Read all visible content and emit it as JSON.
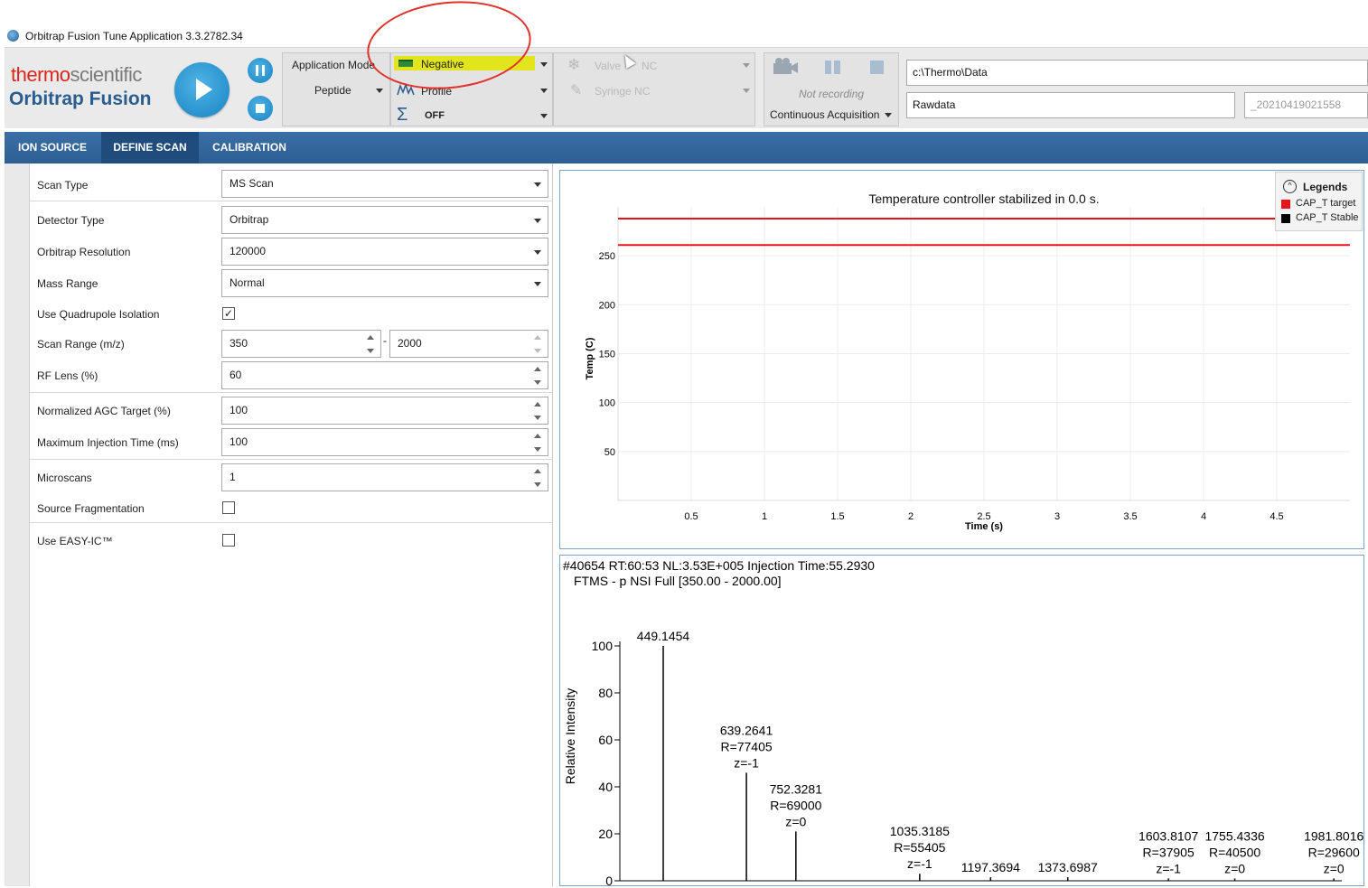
{
  "window": {
    "title": "Orbitrap Fusion Tune Application 3.3.2782.34"
  },
  "brand": {
    "thermo_red": "thermo",
    "thermo_grey": "scientific",
    "product": "Orbitrap Fusion"
  },
  "toolbar": {
    "app_mode_label": "Application Mode",
    "app_mode_value": "Peptide",
    "polarity": "Negative",
    "scan_data": "Profile",
    "sum_mode": "OFF",
    "valve_label": "Valve",
    "valve_value": "NC",
    "syringe": "Syringe NC",
    "recording_status": "Not recording",
    "acquisition_mode": "Continuous Acquisition",
    "data_path": "c:\\Thermo\\Data",
    "file_name": "Rawdata",
    "file_suffix": "_20210419021558"
  },
  "tabs": [
    {
      "label": "ION SOURCE"
    },
    {
      "label": "DEFINE SCAN"
    },
    {
      "label": "CALIBRATION"
    }
  ],
  "params": {
    "scan_type_label": "Scan Type",
    "scan_type": "MS Scan",
    "detector_label": "Detector Type",
    "detector": "Orbitrap",
    "resolution_label": "Orbitrap Resolution",
    "resolution": "120000",
    "mass_range_label": "Mass Range",
    "mass_range": "Normal",
    "quad_label": "Use Quadrupole Isolation",
    "quad_checked": "✓",
    "scan_range_label": "Scan Range (m/z)",
    "scan_min": "350",
    "scan_sep": "-",
    "scan_max": "2000",
    "rf_label": "RF Lens (%)",
    "rf": "60",
    "agc_label": "Normalized AGC Target (%)",
    "agc": "100",
    "inj_label": "Maximum Injection Time (ms)",
    "inj": "100",
    "micro_label": "Microscans",
    "micro": "1",
    "srcfrag_label": "Source Fragmentation",
    "easyic_label": "Use EASY-IC™"
  },
  "legend": {
    "title": "Legends",
    "items": [
      {
        "name": "CAP_T target",
        "color": "#e8141a"
      },
      {
        "name": "CAP_T Stable",
        "color": "#000000"
      }
    ]
  },
  "chart_data": [
    {
      "type": "line",
      "title": "Temperature controller stabilized in 0.0 s.",
      "xlabel": "Time (s)",
      "ylabel": "Temp (C)",
      "x_ticks": [
        "0.5",
        "1",
        "1.5",
        "2",
        "2.5",
        "3",
        "3.5",
        "4",
        "4.5"
      ],
      "y_ticks": [
        "50",
        "100",
        "150",
        "200",
        "250"
      ],
      "xlim": [
        0,
        5
      ],
      "ylim": [
        0,
        300
      ],
      "series": [
        {
          "name": "CAP_T target",
          "x": [
            0,
            5
          ],
          "y": [
            288,
            288
          ],
          "color": "#e8141a"
        },
        {
          "name": "CAP_T Stable",
          "x": [
            0,
            5
          ],
          "y": [
            261,
            261
          ],
          "color": "#e8141a"
        }
      ]
    },
    {
      "type": "bar",
      "header1": "#40654    RT:60:53        NL:3.53E+005        Injection Time:55.2930",
      "header2": "FTMS - p NSI Full [350.00 - 2000.00]",
      "ylabel": "Relative Intensity",
      "y_ticks": [
        "0",
        "20",
        "40",
        "60",
        "80",
        "100"
      ],
      "xlim": [
        350,
        2000
      ],
      "ylim": [
        0,
        100
      ],
      "peaks": [
        {
          "mz": 449.1454,
          "y": 100,
          "label": [
            "449.1454"
          ]
        },
        {
          "mz": 639.2641,
          "y": 46,
          "label": [
            "639.2641",
            "R=77405",
            "z=-1"
          ]
        },
        {
          "mz": 752.3281,
          "y": 21,
          "label": [
            "752.3281",
            "R=69000",
            "z=0"
          ]
        },
        {
          "mz": 1035.3185,
          "y": 3,
          "label": [
            "1035.3185",
            "R=55405",
            "z=-1"
          ]
        },
        {
          "mz": 1197.3694,
          "y": 1.5,
          "label": [
            "1197.3694"
          ]
        },
        {
          "mz": 1373.6987,
          "y": 1.5,
          "label": [
            "1373.6987"
          ]
        },
        {
          "mz": 1603.8107,
          "y": 1,
          "label": [
            "1603.8107",
            "R=37905",
            "z=-1"
          ]
        },
        {
          "mz": 1755.4336,
          "y": 1,
          "label": [
            "1755.4336",
            "R=40500",
            "z=0"
          ]
        },
        {
          "mz": 1981.8016,
          "y": 1,
          "label": [
            "1981.8016",
            "R=29600",
            "z=0"
          ]
        }
      ]
    }
  ]
}
